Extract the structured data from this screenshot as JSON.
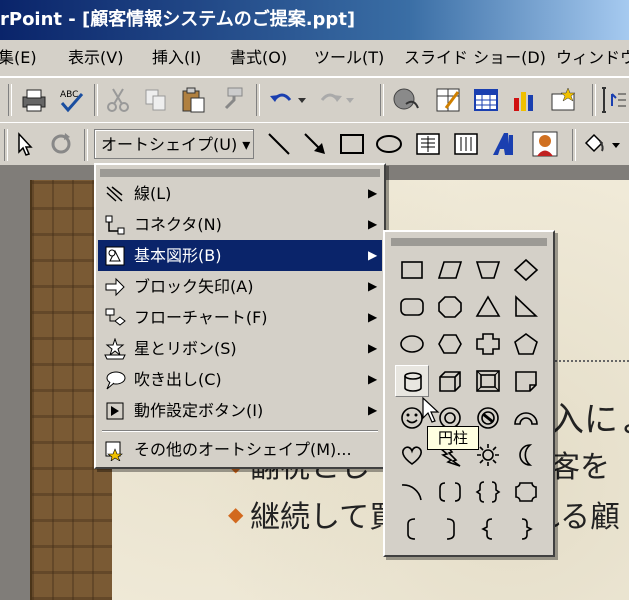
{
  "window": {
    "title": "rPoint - [顧客情報システムのご提案.ppt]"
  },
  "menubar": {
    "items": [
      {
        "label": "集(E)"
      },
      {
        "label": "表示(V)"
      },
      {
        "label": "挿入(I)"
      },
      {
        "label": "書式(O)"
      },
      {
        "label": "ツール(T)"
      },
      {
        "label": "スライド ショー(D)"
      },
      {
        "label": "ウィンドウ"
      }
    ]
  },
  "drawing_toolbar": {
    "autoshape_label": "オートシェイプ(U) ▾"
  },
  "autoshape_menu": {
    "items": [
      {
        "label": "線(L)",
        "icon": "line-icon",
        "has_submenu": true,
        "highlighted": false
      },
      {
        "label": "コネクタ(N)",
        "icon": "connector-icon",
        "has_submenu": true,
        "highlighted": false
      },
      {
        "label": "基本図形(B)",
        "icon": "basic-shapes-icon",
        "has_submenu": true,
        "highlighted": true
      },
      {
        "label": "ブロック矢印(A)",
        "icon": "block-arrow-icon",
        "has_submenu": true,
        "highlighted": false
      },
      {
        "label": "フローチャート(F)",
        "icon": "flowchart-icon",
        "has_submenu": true,
        "highlighted": false
      },
      {
        "label": "星とリボン(S)",
        "icon": "star-ribbon-icon",
        "has_submenu": true,
        "highlighted": false
      },
      {
        "label": "吹き出し(C)",
        "icon": "callout-icon",
        "has_submenu": true,
        "highlighted": false
      },
      {
        "label": "動作設定ボタン(I)",
        "icon": "action-button-icon",
        "has_submenu": true,
        "highlighted": false
      },
      {
        "label": "その他のオートシェイプ(M)...",
        "icon": "more-autoshapes-icon",
        "has_submenu": false,
        "highlighted": false
      }
    ],
    "arrow_glyph": "▶"
  },
  "basic_shapes": {
    "shapes": [
      "rectangle",
      "parallelogram",
      "trapezoid",
      "diamond",
      "rounded-rectangle",
      "octagon",
      "triangle",
      "right-triangle",
      "oval",
      "hexagon",
      "cross",
      "pentagon",
      "cylinder",
      "cube",
      "bevel",
      "folded-corner",
      "smiley",
      "donut",
      "no-symbol",
      "block-arc",
      "heart",
      "lightning",
      "sun",
      "moon",
      "arc",
      "double-bracket",
      "double-brace",
      "plaque",
      "left-bracket",
      "right-bracket",
      "left-brace",
      "right-brace"
    ],
    "hovered_index": 12
  },
  "tooltip": {
    "text": "円柱"
  },
  "slide": {
    "line1_fragment": "入にょ",
    "line2_left": "翻祝とし",
    "line2_right": "顧客を",
    "line3_left": "継続して買",
    "line3_right": "れる顧"
  }
}
